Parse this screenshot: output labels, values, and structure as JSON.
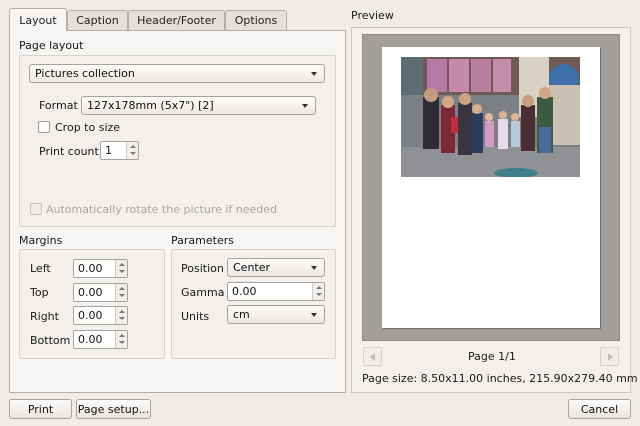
{
  "tabs": [
    {
      "label": "Layout",
      "active": true
    },
    {
      "label": "Caption",
      "active": false
    },
    {
      "label": "Header/Footer",
      "active": false
    },
    {
      "label": "Options",
      "active": false
    }
  ],
  "page_layout": {
    "title": "Page layout",
    "layout_select": "Pictures collection",
    "format_label": "Format",
    "format_select": "127x178mm (5x7\") [2]",
    "crop_label": "Crop to size",
    "crop_checked": false,
    "print_count_label": "Print count",
    "print_count_value": "1",
    "auto_rotate_label": "Automatically rotate the picture if needed",
    "auto_rotate_enabled": false
  },
  "margins": {
    "title": "Margins",
    "left_label": "Left",
    "left_value": "0.00",
    "top_label": "Top",
    "top_value": "0.00",
    "right_label": "Right",
    "right_value": "0.00",
    "bottom_label": "Bottom",
    "bottom_value": "0.00"
  },
  "parameters": {
    "title": "Parameters",
    "position_label": "Position",
    "position_value": "Center",
    "gamma_label": "Gamma",
    "gamma_value": "0.00",
    "units_label": "Units",
    "units_value": "cm"
  },
  "preview": {
    "title": "Preview",
    "page_indicator": "Page 1/1",
    "page_size": "Page size: 8.50x11.00 inches, 215.90x279.40 mm"
  },
  "buttons": {
    "print": "Print",
    "page_setup": "Page setup...",
    "cancel": "Cancel"
  }
}
